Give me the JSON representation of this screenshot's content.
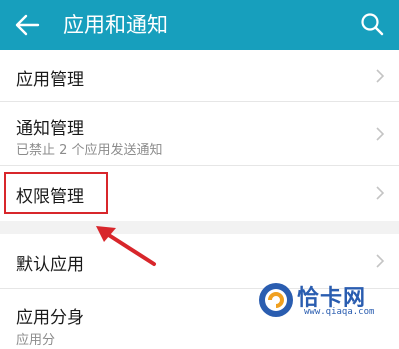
{
  "header": {
    "title": "应用和通知",
    "back_icon": "arrow-left-icon",
    "search_icon": "search-icon",
    "bg_color": "#179fbd"
  },
  "items": [
    {
      "label": "应用管理"
    },
    {
      "label": "通知管理",
      "subtitle": "已禁止 2 个应用发送通知"
    },
    {
      "label": "权限管理"
    },
    {
      "label": "默认应用"
    },
    {
      "label": "应用分身",
      "subtitle": "应用分"
    }
  ],
  "annotation": {
    "highlight_color": "#d8262b"
  },
  "watermark": {
    "brand": "恰卡网",
    "url": "www.qiaqa.com"
  }
}
